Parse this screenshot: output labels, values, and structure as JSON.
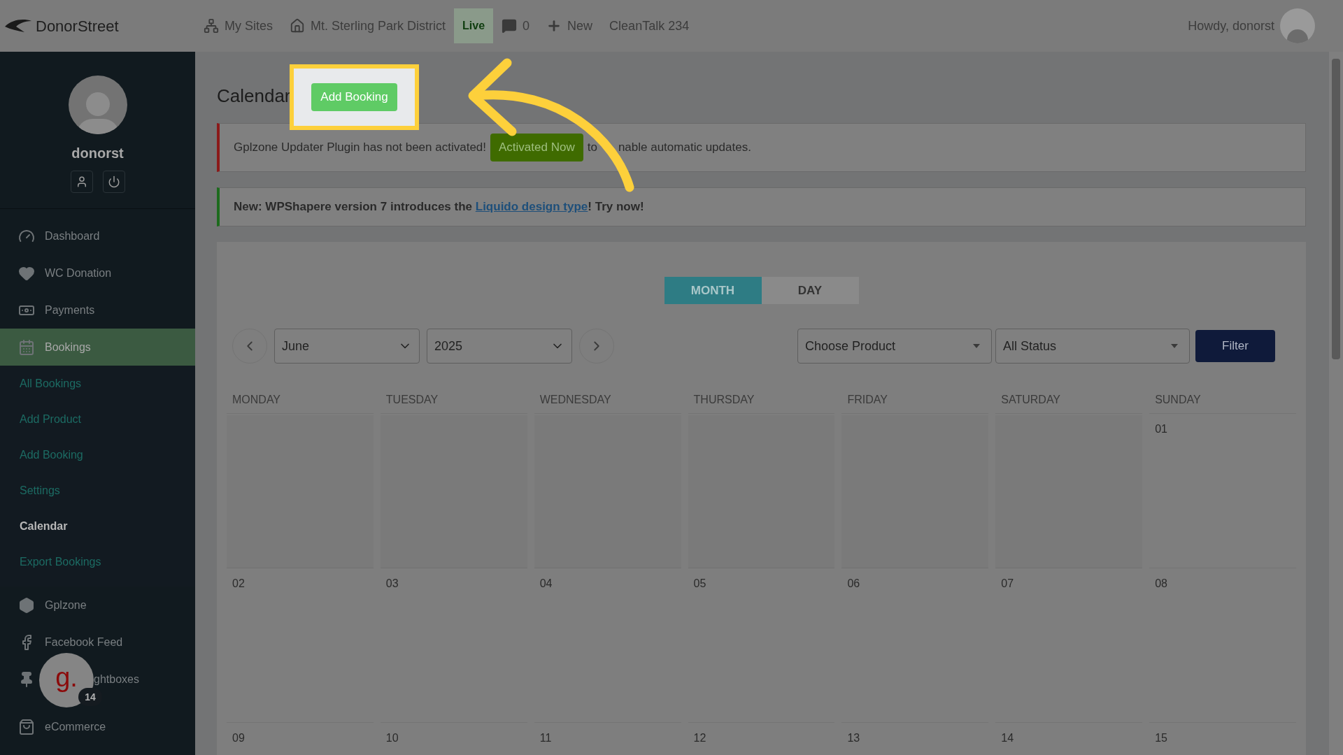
{
  "top_bar": {
    "logo": "DonorStreet",
    "items": [
      {
        "kind": "sites",
        "label": "My Sites",
        "selected": false
      },
      {
        "kind": "home",
        "label": "Mt. Sterling Park District",
        "selected": false
      },
      {
        "kind": "plain",
        "label": "Live",
        "selected": true
      },
      {
        "kind": "comments",
        "label": "0",
        "selected": false
      },
      {
        "kind": "new",
        "label": "New",
        "selected": false
      },
      {
        "kind": "plain",
        "label": "CleanTalk 234",
        "selected": false
      }
    ],
    "greeting": "Howdy, donorst"
  },
  "sidebar": {
    "user": "donorst",
    "items": [
      {
        "kind": "gauge",
        "label": "Dashboard",
        "selected": false
      },
      {
        "kind": "heart",
        "label": "WC Donation",
        "selected": false
      },
      {
        "kind": "money",
        "label": "Payments",
        "selected": false
      },
      {
        "kind": "calendar",
        "label": "Bookings",
        "selected": true,
        "children": [
          {
            "label": "All Bookings",
            "selected": false
          },
          {
            "label": "Add Product",
            "selected": false
          },
          {
            "label": "Add Booking",
            "selected": false
          },
          {
            "label": "Settings",
            "selected": false
          },
          {
            "label": "Calendar",
            "selected": true
          },
          {
            "label": "Export Bookings",
            "selected": false
          }
        ]
      },
      {
        "kind": "hexagon",
        "label": "Gplzone",
        "selected": false
      },
      {
        "kind": "facebook",
        "label": "Facebook Feed",
        "selected": false
      },
      {
        "kind": "pin",
        "label": "ghtboxes",
        "selected": false
      },
      {
        "kind": "bag",
        "label": "eCommerce",
        "selected": false
      }
    ]
  },
  "chat_bubble": {
    "logo": "g.",
    "badge": "14"
  },
  "page": {
    "title": "Calendar",
    "add_button": "Add Booking"
  },
  "notices": [
    {
      "kind": "error",
      "before": "Gplzone Updater Plugin has not been activated!",
      "button": "Activated Now",
      "after": "to",
      "after_2": "nable automatic updates."
    },
    {
      "kind": "success",
      "before": "New: WPShapere version 7 introduces the ",
      "link": "Liquido design type",
      "after": "! Try now!"
    }
  ],
  "calendar": {
    "views": [
      {
        "label": "MONTH",
        "selected": true
      },
      {
        "label": "DAY",
        "selected": false
      }
    ],
    "month": "June",
    "year": "2025",
    "product": "Choose Product",
    "status": "All Status",
    "filter_button": "Filter",
    "weekdays": [
      "MONDAY",
      "TUESDAY",
      "WEDNESDAY",
      "THURSDAY",
      "FRIDAY",
      "SATURDAY",
      "SUNDAY"
    ],
    "weeks": [
      [
        "01"
      ],
      [
        "02",
        "03",
        "04",
        "05",
        "06",
        "07",
        "08"
      ],
      [
        "09",
        "10",
        "11",
        "12",
        "13",
        "14",
        "15"
      ]
    ]
  }
}
